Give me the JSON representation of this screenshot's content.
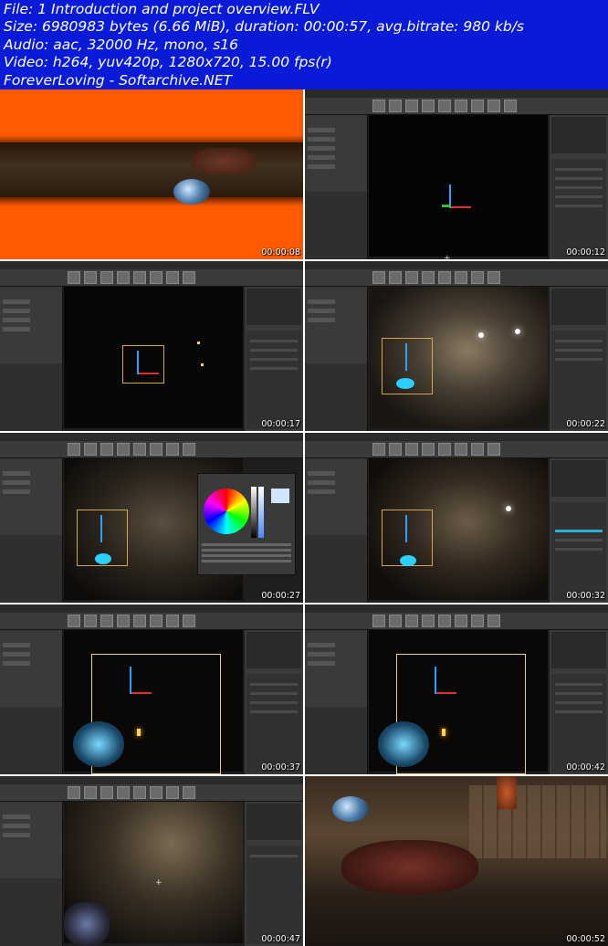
{
  "header": {
    "lines": [
      "File: 1 Introduction and project overview.FLV",
      "Size: 6980983 bytes (6.66 MiB), duration: 00:00:57, avg.bitrate: 980 kb/s",
      "Audio: aac, 32000 Hz, mono, s16",
      "Video: h264, yuv420p, 1280x720, 15.00 fps(r)",
      "ForeverLoving - Softarchive.NET"
    ]
  },
  "thumbnails": [
    {
      "timestamp": "00:00:08"
    },
    {
      "timestamp": "00:00:12"
    },
    {
      "timestamp": "00:00:17"
    },
    {
      "timestamp": "00:00:22"
    },
    {
      "timestamp": "00:00:27"
    },
    {
      "timestamp": "00:00:32"
    },
    {
      "timestamp": "00:00:37"
    },
    {
      "timestamp": "00:00:42"
    },
    {
      "timestamp": "00:00:47"
    },
    {
      "timestamp": "00:00:52"
    }
  ],
  "colors": {
    "header_bg": "#0a1bd8",
    "header_text": "#ffffff",
    "accent_orange": "#ff5a00"
  }
}
